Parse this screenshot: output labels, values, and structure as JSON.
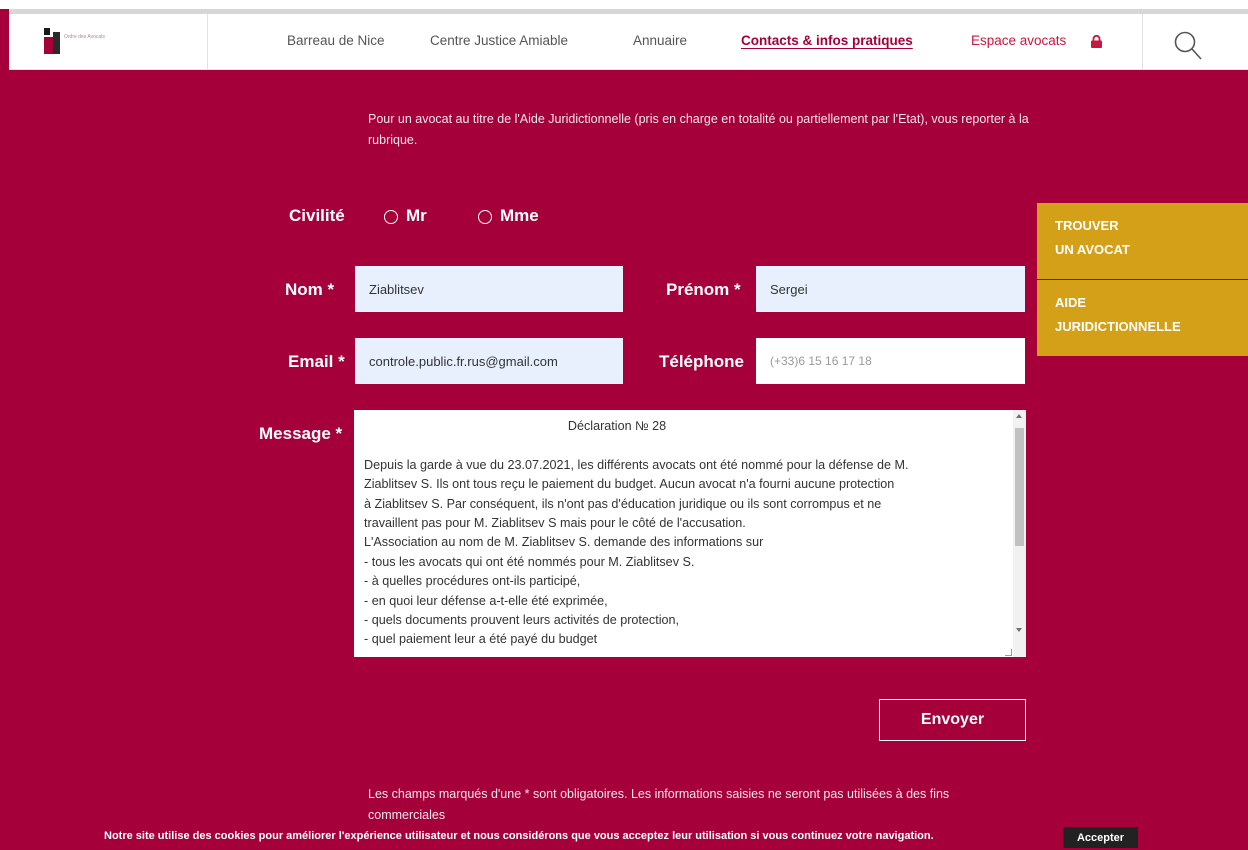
{
  "header": {
    "logo_text": "Ordre des Avocats",
    "nav": [
      {
        "label": "Barreau de Nice"
      },
      {
        "label": "Centre Justice Amiable"
      },
      {
        "label": "Annuaire"
      },
      {
        "label": "Contacts & infos pratiques"
      },
      {
        "label": "Espace avocats"
      }
    ],
    "icons": [
      "lock-icon",
      "search-icon"
    ]
  },
  "intro": "Pour un avocat au titre de l'Aide Juridictionnelle (pris en charge en totalité ou partiellement par l'Etat), vous reporter à la rubrique.",
  "form": {
    "civilite": {
      "label": "Civilité",
      "options": [
        "Mr",
        "Mme"
      ]
    },
    "nom": {
      "label": "Nom *",
      "value": "Ziablitsev"
    },
    "prenom": {
      "label": "Prénom *",
      "value": "Sergei"
    },
    "email": {
      "label": "Email *",
      "value": "controle.public.fr.rus@gmail.com"
    },
    "telephone": {
      "label": "Téléphone",
      "placeholder": "(+33)6 15 16 17 18"
    },
    "message": {
      "label": "Message *",
      "title": "Déclaration № 28",
      "lines": [
        "Depuis la garde à vue du 23.07.2021, les différents avocats ont été nommé pour la défense de M.",
        "Ziablitsev S.  Ils ont tous reçu le paiement du budget. Aucun avocat n'a fourni aucune protection",
        "à Ziablitsev S. Par conséquent, ils n'ont pas d'éducation juridique ou ils sont corrompus et ne",
        "travaillent pas pour M. Ziablitsev S   mais pour le côté de l'accusation.",
        "L'Association au nom de  M. Ziablitsev S.  demande des informations sur",
        "- tous les avocats qui ont été nommés pour M. Ziablitsev S.",
        "- à quelles procédures ont-ils participé,",
        "- en quoi leur défense a-t-elle été exprimée,",
        "- quels documents prouvent leurs activités de protection,",
        "- quel paiement leur a été payé du budget"
      ]
    },
    "submit_label": "Envoyer",
    "footnote": "Les champs marqués d'une * sont obligatoires. Les informations saisies ne seront pas utilisées à des fins commerciales"
  },
  "side_tabs": [
    {
      "line1": "TROUVER",
      "line2": "UN AVOCAT"
    },
    {
      "line1": "AIDE",
      "line2": "JURIDICTIONNELLE"
    }
  ],
  "cookie": {
    "text": "Notre site utilise des cookies pour améliorer l'expérience utilisateur et nous considérons que vous acceptez leur utilisation si vous continuez votre navigation.",
    "accept_label": "Accepter"
  },
  "colors": {
    "brand": "#a5003a",
    "gold": "#d4a017",
    "field_filled": "#e8f0fe"
  }
}
